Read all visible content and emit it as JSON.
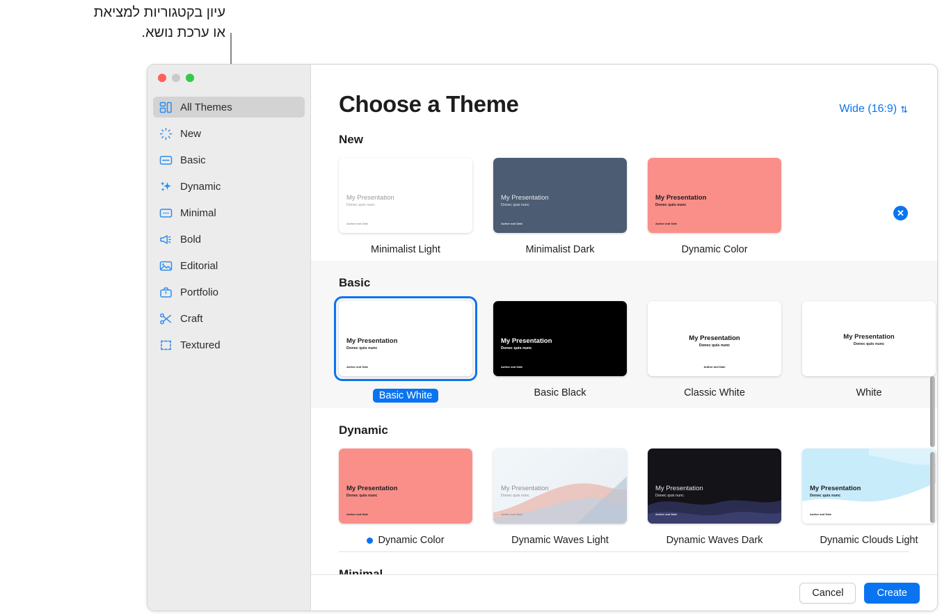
{
  "callout": {
    "text": "עיון בקטגוריות למציאת\nאו ערכת נושא."
  },
  "window": {
    "traffic_lights": [
      "close-red",
      "minimize-yellow",
      "zoom-green"
    ]
  },
  "sidebar": {
    "items": [
      {
        "label": "All Themes",
        "icon": "all-themes-icon",
        "active": true
      },
      {
        "label": "New",
        "icon": "sparkle-burst-icon",
        "active": false
      },
      {
        "label": "Basic",
        "icon": "basic-slide-icon",
        "active": false
      },
      {
        "label": "Dynamic",
        "icon": "sparkles-icon",
        "active": false
      },
      {
        "label": "Minimal",
        "icon": "minimal-dots-icon",
        "active": false
      },
      {
        "label": "Bold",
        "icon": "megaphone-icon",
        "active": false
      },
      {
        "label": "Editorial",
        "icon": "photo-icon",
        "active": false
      },
      {
        "label": "Portfolio",
        "icon": "briefcase-icon",
        "active": false
      },
      {
        "label": "Craft",
        "icon": "scissors-icon",
        "active": false
      },
      {
        "label": "Textured",
        "icon": "crop-frame-icon",
        "active": false
      }
    ]
  },
  "header": {
    "title": "Choose a Theme",
    "aspect_ratio": "Wide (16:9)",
    "aspect_ratio_chevron": "⌃⌄",
    "close_label": "✕"
  },
  "slide_text": {
    "title": "My Presentation",
    "subtitle": "Donec quis nunc",
    "author": "Author and Date"
  },
  "sections": [
    {
      "title": "New",
      "shaded": false,
      "themes": [
        {
          "name": "Minimalist Light",
          "selected": false,
          "has_dot": false
        },
        {
          "name": "Minimalist Dark",
          "selected": false,
          "has_dot": false
        },
        {
          "name": "Dynamic Color",
          "selected": false,
          "has_dot": false
        }
      ]
    },
    {
      "title": "Basic",
      "shaded": true,
      "themes": [
        {
          "name": "Basic White",
          "selected": true,
          "has_dot": false
        },
        {
          "name": "Basic Black",
          "selected": false,
          "has_dot": false
        },
        {
          "name": "Classic White",
          "selected": false,
          "has_dot": false
        },
        {
          "name": "White",
          "selected": false,
          "has_dot": false
        }
      ]
    },
    {
      "title": "Dynamic",
      "shaded": false,
      "themes": [
        {
          "name": "Dynamic Color",
          "selected": false,
          "has_dot": true
        },
        {
          "name": "Dynamic Waves Light",
          "selected": false,
          "has_dot": false
        },
        {
          "name": "Dynamic Waves Dark",
          "selected": false,
          "has_dot": false
        },
        {
          "name": "Dynamic Clouds Light",
          "selected": false,
          "has_dot": false
        }
      ]
    },
    {
      "title": "Minimal",
      "shaded": false,
      "themes": []
    }
  ],
  "footer": {
    "cancel_label": "Cancel",
    "create_label": "Create"
  },
  "colors": {
    "accent": "#0a74f0",
    "minimalist_dark": "#4c5c73",
    "dynamic_color": "#fa8f8a",
    "basic_black": "#000000",
    "waves_dark": "#131318",
    "clouds_light": "#c9ecfb"
  }
}
